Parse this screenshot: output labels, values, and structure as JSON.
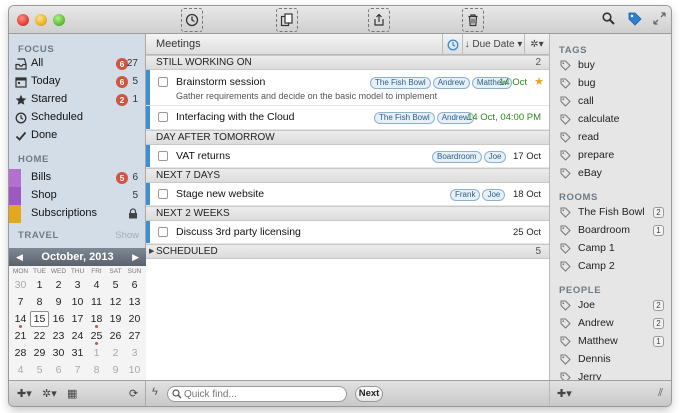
{
  "sidebar": {
    "focus_title": "FOCUS",
    "focus_items": [
      {
        "label": "All",
        "badge": "6",
        "count": "27"
      },
      {
        "label": "Today",
        "badge": "6",
        "count": "5"
      },
      {
        "label": "Starred",
        "badge": "2",
        "count": "1"
      },
      {
        "label": "Scheduled",
        "badge": "",
        "count": ""
      },
      {
        "label": "Done",
        "badge": "",
        "count": ""
      }
    ],
    "home_title": "HOME",
    "home_items": [
      {
        "label": "Bills",
        "badge": "5",
        "count": "6",
        "color": "#b56fd1"
      },
      {
        "label": "Shop",
        "badge": "",
        "count": "5",
        "color": "#9e58c2"
      },
      {
        "label": "Subscriptions",
        "badge": "",
        "count": "",
        "color": "#e3a81b"
      }
    ],
    "travel_title": "TRAVEL",
    "travel_show": "Show"
  },
  "calendar": {
    "month": "October, 2013",
    "dows": [
      "MON",
      "TUE",
      "WED",
      "THU",
      "FRI",
      "SAT",
      "SUN"
    ],
    "weeks": [
      [
        "30",
        "1",
        "2",
        "3",
        "4",
        "5",
        "6"
      ],
      [
        "7",
        "8",
        "9",
        "10",
        "11",
        "12",
        "13"
      ],
      [
        "14",
        "15",
        "16",
        "17",
        "18",
        "19",
        "20"
      ],
      [
        "21",
        "22",
        "23",
        "24",
        "25",
        "26",
        "27"
      ],
      [
        "28",
        "29",
        "30",
        "31",
        "1",
        "2",
        "3"
      ],
      [
        "4",
        "5",
        "6",
        "7",
        "8",
        "9",
        "10"
      ]
    ],
    "leading": [
      "28",
      "29"
    ]
  },
  "main": {
    "title": "Meetings",
    "sort_label": "Due Date",
    "groups": [
      {
        "label": "STILL WORKING ON",
        "count": "2"
      },
      {
        "label": "DAY AFTER TOMORROW",
        "count": ""
      },
      {
        "label": "NEXT 7 DAYS",
        "count": ""
      },
      {
        "label": "NEXT 2 WEEKS",
        "count": ""
      },
      {
        "label": "SCHEDULED",
        "count": "5"
      }
    ],
    "tasks": [
      {
        "title": "Brainstorm session",
        "note": "Gather requirements and decide on the basic model to implement",
        "tags": [
          "The Fish Bowl",
          "Andrew",
          "Matthew"
        ],
        "date": "14 Oct"
      },
      {
        "title": "Interfacing with the Cloud",
        "note": "",
        "tags": [
          "The Fish Bowl",
          "Andrew"
        ],
        "date": "14 Oct, 04:00 PM"
      },
      {
        "title": "VAT returns",
        "note": "",
        "tags": [
          "Boardroom",
          "Joe"
        ],
        "date": "17 Oct"
      },
      {
        "title": "Stage new website",
        "note": "",
        "tags": [
          "Frank",
          "Joe"
        ],
        "date": "18 Oct"
      },
      {
        "title": "Discuss 3rd party licensing",
        "note": "",
        "tags": [],
        "date": "25 Oct"
      }
    ]
  },
  "bottom": {
    "quick_placeholder": "Quick find...",
    "next_label": "Next"
  },
  "tagpanel": {
    "tags_title": "TAGS",
    "tags": [
      "buy",
      "bug",
      "call",
      "calculate",
      "read",
      "prepare",
      "eBay"
    ],
    "rooms_title": "ROOMS",
    "rooms": [
      {
        "label": "The Fish Bowl",
        "count": "2"
      },
      {
        "label": "Boardroom",
        "count": "1"
      },
      {
        "label": "Camp 1",
        "count": ""
      },
      {
        "label": "Camp 2",
        "count": ""
      }
    ],
    "people_title": "PEOPLE",
    "people": [
      {
        "label": "Joe",
        "count": "2"
      },
      {
        "label": "Andrew",
        "count": "2"
      },
      {
        "label": "Matthew",
        "count": "1"
      },
      {
        "label": "Dennis",
        "count": ""
      },
      {
        "label": "Jerry",
        "count": ""
      }
    ]
  },
  "colors": {
    "accent": "#3d8fd6",
    "badge": "#d2533f",
    "due_green": "#2b8a19",
    "star": "#e8a21a"
  }
}
